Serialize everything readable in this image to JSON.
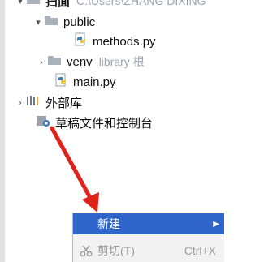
{
  "project_tree": {
    "root": {
      "name": "扫面",
      "path": "C:\\Users\\ZHANG DIXING"
    },
    "items": [
      {
        "label": "public",
        "type": "folder",
        "expanded": true
      },
      {
        "label": "methods.py",
        "type": "python-file"
      },
      {
        "label": "venv",
        "type": "folder",
        "expanded": false,
        "hint": "library 根"
      },
      {
        "label": "main.py",
        "type": "python-file"
      },
      {
        "label": "外部库",
        "type": "library",
        "expanded": false
      },
      {
        "label": "草稿文件和控制台",
        "type": "scratches"
      }
    ]
  },
  "context_menu": {
    "items": [
      {
        "label": "新建",
        "selected": true,
        "has_submenu": true
      },
      {
        "label": "剪切(T)",
        "shortcut": "Ctrl+X",
        "disabled": true,
        "icon": "scissors-icon"
      }
    ]
  },
  "colors": {
    "selection": "#2f65ca",
    "annotation_arrow": "#e0231a",
    "folder": "#a9b2bc",
    "python_blue": "#3c78b4",
    "python_yellow": "#f2c53d"
  }
}
